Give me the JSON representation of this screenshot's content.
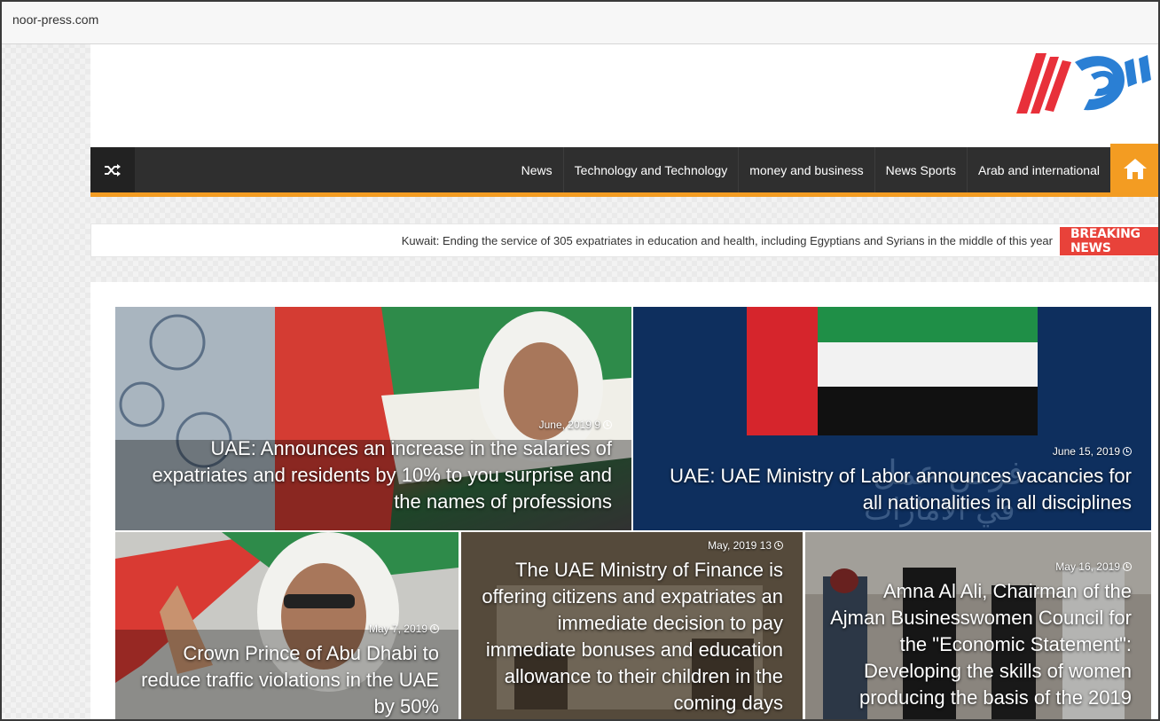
{
  "address_bar": {
    "url": "noor-press.com"
  },
  "nav": {
    "items": [
      "News",
      "Technology and Technology",
      "money and business",
      "News Sports",
      "Arab and international"
    ]
  },
  "ticker": {
    "text": "Kuwait: Ending the service of 305 expatriates in education and health, including Egyptians and Syrians in the middle of this year",
    "badge": "BREAKING NEWS"
  },
  "articles": [
    {
      "date": "June, 2019 9",
      "title": "UAE: Announces an increase in the salaries of expatriates and residents by 10% to you surprise and the names of professions"
    },
    {
      "date": "June 15, 2019",
      "title": "UAE: UAE Ministry of Labor announces vacancies for all nationalities in all disciplines"
    },
    {
      "date": "May 7, 2019",
      "title": "Crown Prince of Abu Dhabi to reduce traffic violations in the UAE by 50%"
    },
    {
      "date": "May, 2019 13",
      "title": "The UAE Ministry of Finance is offering citizens and expatriates an immediate decision to pay immediate bonuses and education allowance to their children in the coming days"
    },
    {
      "date": "May 16, 2019",
      "title": "Amna Al Ali, Chairman of the Ajman Businesswomen Council for the \"Economic Statement\": Developing the skills of women producing the basis of the 2019"
    }
  ],
  "colors": {
    "accent": "#f39c22",
    "navbar": "#2f2f2f",
    "breaking": "#e8423a"
  }
}
